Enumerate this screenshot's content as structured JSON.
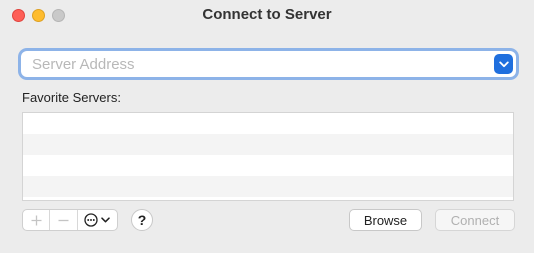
{
  "window": {
    "title": "Connect to Server"
  },
  "address": {
    "placeholder": "Server Address",
    "value": ""
  },
  "favorites": {
    "label": "Favorite Servers:",
    "rows": [
      "",
      "",
      "",
      ""
    ]
  },
  "toolbar": {
    "add_icon": "plus-icon",
    "remove_icon": "minus-icon",
    "more_icon": "ellipsis-circle-icon",
    "help_label": "?"
  },
  "buttons": {
    "browse_label": "Browse",
    "connect_label": "Connect"
  },
  "colors": {
    "accent": "#1f6fde",
    "focus_ring": "#8db3e8",
    "close": "#fe5f57",
    "minimize": "#febc2e",
    "zoom_disabled": "#c9c9c9"
  }
}
